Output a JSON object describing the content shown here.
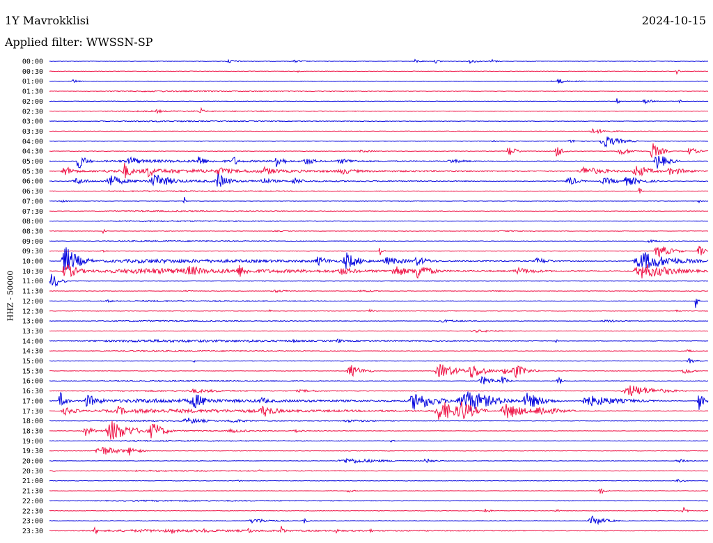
{
  "header": {
    "station": "1Y Mavrokklisi",
    "date": "2024-10-15",
    "filter_text": "Applied filter: WWSSN-SP"
  },
  "chart_data": {
    "type": "line",
    "title": "1Y Mavrokklisi",
    "date": "2024-10-15",
    "filter": "WWSSN-SP",
    "ylabel": "HHZ - 50000",
    "xrange": [
      0,
      30
    ],
    "grid": false,
    "colors": [
      "#0000dd",
      "#ee1144"
    ],
    "rows": [
      {
        "time": "00:00",
        "bursts": [
          [
            8.0,
            1.0,
            3
          ],
          [
            11.0,
            1.2,
            2
          ],
          [
            16.5,
            0.8,
            3
          ],
          [
            17.5,
            0.6,
            3
          ],
          [
            19.0,
            1.0,
            3
          ],
          [
            20.0,
            0.6,
            4
          ]
        ]
      },
      {
        "time": "00:30",
        "bursts": [
          [
            28.5,
            0.3,
            6
          ],
          [
            11.3,
            0.2,
            2
          ]
        ]
      },
      {
        "time": "01:00",
        "bursts": [
          [
            1.0,
            0.6,
            3
          ],
          [
            22.0,
            8.0,
            1
          ],
          [
            23.0,
            0.8,
            5
          ]
        ]
      },
      {
        "time": "01:30",
        "bursts": [
          [
            0.0,
            30.0,
            1
          ]
        ]
      },
      {
        "time": "02:00",
        "bursts": [
          [
            25.8,
            0.3,
            6
          ],
          [
            27.0,
            0.8,
            4
          ],
          [
            28.6,
            0.4,
            3
          ]
        ]
      },
      {
        "time": "02:30",
        "bursts": [
          [
            4.8,
            0.7,
            3
          ],
          [
            6.8,
            0.4,
            6
          ],
          [
            0.0,
            30.0,
            1
          ]
        ]
      },
      {
        "time": "03:00",
        "bursts": [
          [
            0.0,
            30.0,
            1
          ]
        ]
      },
      {
        "time": "03:30",
        "bursts": [
          [
            24.5,
            1.8,
            4
          ],
          [
            8.3,
            0.3,
            1
          ]
        ]
      },
      {
        "time": "04:00",
        "bursts": [
          [
            25.0,
            1.8,
            9
          ],
          [
            23.5,
            1.5,
            2
          ],
          [
            20.0,
            1.5,
            1
          ]
        ]
      },
      {
        "time": "04:30",
        "bursts": [
          [
            20.8,
            0.8,
            9
          ],
          [
            23.0,
            0.7,
            10
          ],
          [
            25.8,
            1.2,
            6
          ],
          [
            27.3,
            1.0,
            13
          ],
          [
            29.0,
            1.0,
            6
          ],
          [
            14.0,
            1.5,
            2
          ]
        ]
      },
      {
        "time": "05:00",
        "bursts": [
          [
            0.0,
            30.0,
            2
          ],
          [
            1.2,
            0.8,
            13
          ],
          [
            3.5,
            1.2,
            8
          ],
          [
            6.7,
            0.6,
            12
          ],
          [
            8.3,
            0.5,
            9
          ],
          [
            10.2,
            0.8,
            12
          ],
          [
            11.5,
            1.2,
            6
          ],
          [
            13.0,
            2.0,
            4
          ],
          [
            18.0,
            2.0,
            3
          ],
          [
            27.5,
            1.2,
            12
          ]
        ]
      },
      {
        "time": "05:30",
        "bursts": [
          [
            0.0,
            30.0,
            3
          ],
          [
            0.5,
            1.2,
            8
          ],
          [
            3.3,
            0.8,
            13
          ],
          [
            4.3,
            1.2,
            10
          ],
          [
            7.5,
            1.6,
            7
          ],
          [
            9.5,
            2.0,
            6
          ],
          [
            13.0,
            2.0,
            5
          ],
          [
            24.0,
            2.5,
            7
          ],
          [
            26.5,
            1.5,
            10
          ],
          [
            28.0,
            2.0,
            6
          ]
        ]
      },
      {
        "time": "06:00",
        "bursts": [
          [
            0.0,
            30.0,
            2
          ],
          [
            1.0,
            1.5,
            5
          ],
          [
            2.5,
            1.5,
            10
          ],
          [
            4.5,
            2.0,
            11
          ],
          [
            7.5,
            1.2,
            12
          ],
          [
            9.5,
            1.5,
            5
          ],
          [
            11.0,
            1.0,
            6
          ],
          [
            23.5,
            1.0,
            8
          ],
          [
            25.0,
            2.0,
            5
          ],
          [
            26.0,
            2.0,
            7
          ]
        ]
      },
      {
        "time": "06:30",
        "bursts": [
          [
            0.0,
            30.0,
            1
          ],
          [
            26.8,
            0.3,
            6
          ]
        ]
      },
      {
        "time": "07:00",
        "bursts": [
          [
            6.1,
            0.2,
            8
          ],
          [
            0.3,
            1.0,
            2
          ],
          [
            29.5,
            0.3,
            3
          ]
        ]
      },
      {
        "time": "07:30",
        "bursts": [
          [
            0.0,
            30.0,
            1
          ]
        ]
      },
      {
        "time": "08:00",
        "bursts": [
          [
            0.0,
            30.0,
            1
          ]
        ]
      },
      {
        "time": "08:30",
        "bursts": [
          [
            2.4,
            0.3,
            4
          ],
          [
            10.0,
            2.0,
            1
          ],
          [
            20.0,
            5.0,
            1
          ]
        ]
      },
      {
        "time": "09:00",
        "bursts": [
          [
            0.0,
            30.0,
            1
          ],
          [
            27.0,
            2.0,
            2
          ]
        ]
      },
      {
        "time": "09:30",
        "bursts": [
          [
            2.3,
            0.5,
            3
          ],
          [
            15.0,
            0.3,
            9
          ],
          [
            27.5,
            1.5,
            10
          ],
          [
            29.5,
            0.5,
            12
          ]
        ]
      },
      {
        "time": "10:00",
        "bursts": [
          [
            0.0,
            30.0,
            3
          ],
          [
            0.5,
            1.5,
            22
          ],
          [
            12.0,
            1.5,
            7
          ],
          [
            13.3,
            1.5,
            13
          ],
          [
            15.0,
            2.5,
            6
          ],
          [
            16.5,
            1.5,
            7
          ],
          [
            22.0,
            1.5,
            5
          ],
          [
            26.5,
            3.5,
            14
          ]
        ]
      },
      {
        "time": "10:30",
        "bursts": [
          [
            0.0,
            30.0,
            4
          ],
          [
            0.5,
            1.5,
            12
          ],
          [
            6.0,
            2.5,
            8
          ],
          [
            8.5,
            1.0,
            10
          ],
          [
            13.0,
            2.0,
            6
          ],
          [
            15.5,
            1.5,
            10
          ],
          [
            16.5,
            1.5,
            13
          ],
          [
            21.0,
            2.5,
            5
          ],
          [
            26.5,
            3.5,
            12
          ]
        ]
      },
      {
        "time": "11:00",
        "bursts": [
          [
            0.0,
            0.8,
            13
          ]
        ]
      },
      {
        "time": "11:30",
        "bursts": [
          [
            6.0,
            1.5,
            1
          ],
          [
            10.0,
            2.0,
            2
          ],
          [
            14.0,
            1.5,
            2
          ],
          [
            20.0,
            1.5,
            1
          ]
        ]
      },
      {
        "time": "12:00",
        "bursts": [
          [
            0.0,
            30.0,
            1
          ],
          [
            2.5,
            1.0,
            2
          ],
          [
            29.4,
            0.2,
            12
          ]
        ]
      },
      {
        "time": "12:30",
        "bursts": [
          [
            10.0,
            0.2,
            3
          ],
          [
            14.5,
            0.5,
            3
          ],
          [
            28.5,
            0.3,
            4
          ]
        ]
      },
      {
        "time": "13:00",
        "bursts": [
          [
            0.0,
            30.0,
            1
          ],
          [
            17.5,
            3.0,
            2
          ],
          [
            25.0,
            2.5,
            2
          ]
        ]
      },
      {
        "time": "13:30",
        "bursts": [
          [
            19.0,
            3.0,
            2
          ]
        ]
      },
      {
        "time": "14:00",
        "bursts": [
          [
            0.0,
            30.0,
            2
          ],
          [
            9.0,
            1.0,
            3
          ],
          [
            11.0,
            0.8,
            3
          ],
          [
            13.0,
            0.7,
            4
          ],
          [
            23.0,
            0.4,
            3
          ]
        ]
      },
      {
        "time": "14:30",
        "bursts": [
          [
            0.0,
            30.0,
            1
          ],
          [
            29.0,
            0.5,
            3
          ]
        ]
      },
      {
        "time": "15:00",
        "bursts": [
          [
            6.5,
            0.2,
            4
          ],
          [
            29.0,
            0.8,
            4
          ]
        ]
      },
      {
        "time": "15:30",
        "bursts": [
          [
            13.5,
            1.3,
            10
          ],
          [
            17.5,
            2.0,
            11
          ],
          [
            19.0,
            1.5,
            12
          ],
          [
            20.5,
            1.5,
            5
          ],
          [
            21.0,
            1.3,
            11
          ],
          [
            28.8,
            0.8,
            6
          ]
        ]
      },
      {
        "time": "16:00",
        "bursts": [
          [
            0.0,
            30.0,
            1
          ],
          [
            19.5,
            1.5,
            7
          ],
          [
            20.5,
            0.6,
            9
          ],
          [
            23.1,
            0.4,
            9
          ]
        ]
      },
      {
        "time": "16:30",
        "bursts": [
          [
            0.0,
            30.0,
            1
          ],
          [
            6.0,
            4.0,
            3
          ],
          [
            11.0,
            3.0,
            2
          ],
          [
            26.0,
            3.0,
            9
          ]
        ]
      },
      {
        "time": "17:00",
        "bursts": [
          [
            0.0,
            30.0,
            3
          ],
          [
            0.4,
            0.6,
            14
          ],
          [
            1.5,
            1.5,
            10
          ],
          [
            6.3,
            1.8,
            12
          ],
          [
            9.5,
            1.0,
            6
          ],
          [
            16.3,
            2.3,
            15
          ],
          [
            18.5,
            3.0,
            18
          ],
          [
            21.5,
            1.8,
            13
          ],
          [
            24.0,
            4.0,
            8
          ],
          [
            29.5,
            0.5,
            14
          ]
        ]
      },
      {
        "time": "17:30",
        "bursts": [
          [
            0.0,
            30.0,
            3
          ],
          [
            0.5,
            1.5,
            6
          ],
          [
            3.0,
            1.0,
            8
          ],
          [
            9.5,
            1.5,
            10
          ],
          [
            17.5,
            2.0,
            17
          ],
          [
            18.5,
            1.5,
            18
          ],
          [
            20.5,
            2.0,
            13
          ],
          [
            22.0,
            2.0,
            9
          ]
        ]
      },
      {
        "time": "18:00",
        "bursts": [
          [
            0.0,
            30.0,
            1
          ],
          [
            6.0,
            2.0,
            5
          ],
          [
            8.0,
            2.0,
            3
          ],
          [
            13.0,
            4.0,
            2
          ]
        ]
      },
      {
        "time": "18:30",
        "bursts": [
          [
            0.0,
            30.0,
            1
          ],
          [
            1.5,
            1.0,
            7
          ],
          [
            2.5,
            2.2,
            16
          ],
          [
            4.5,
            1.2,
            15
          ],
          [
            8.0,
            2.0,
            3
          ],
          [
            11.0,
            1.0,
            3
          ]
        ]
      },
      {
        "time": "19:00",
        "bursts": [
          [
            0.0,
            30.0,
            1
          ],
          [
            15.5,
            0.3,
            3
          ]
        ]
      },
      {
        "time": "19:30",
        "bursts": [
          [
            2.0,
            2.0,
            8
          ],
          [
            3.5,
            1.0,
            7
          ]
        ]
      },
      {
        "time": "20:00",
        "bursts": [
          [
            13.0,
            4.0,
            4
          ],
          [
            17.0,
            1.0,
            4
          ],
          [
            28.5,
            1.0,
            4
          ]
        ]
      },
      {
        "time": "20:30",
        "bursts": [
          [
            0.0,
            30.0,
            1
          ],
          [
            0.0,
            0.3,
            4
          ],
          [
            9.5,
            0.3,
            3
          ]
        ]
      },
      {
        "time": "21:00",
        "bursts": [
          [
            8.5,
            0.5,
            2
          ],
          [
            28.5,
            0.6,
            4
          ]
        ]
      },
      {
        "time": "21:30",
        "bursts": [
          [
            13.5,
            0.6,
            3
          ],
          [
            25.0,
            0.5,
            7
          ]
        ]
      },
      {
        "time": "22:00",
        "bursts": [
          [
            0.0,
            30.0,
            1
          ]
        ]
      },
      {
        "time": "22:30",
        "bursts": [
          [
            19.8,
            0.4,
            6
          ],
          [
            23.0,
            0.4,
            3
          ],
          [
            28.8,
            0.4,
            6
          ]
        ]
      },
      {
        "time": "23:00",
        "bursts": [
          [
            9.0,
            2.0,
            4
          ],
          [
            11.5,
            0.4,
            6
          ],
          [
            24.5,
            1.5,
            7
          ]
        ]
      },
      {
        "time": "23:30",
        "bursts": [
          [
            0.0,
            30.0,
            2
          ],
          [
            2.0,
            0.4,
            6
          ],
          [
            4.0,
            0.4,
            4
          ],
          [
            5.5,
            0.4,
            6
          ],
          [
            7.0,
            0.4,
            6
          ],
          [
            9.0,
            0.4,
            6
          ],
          [
            10.5,
            0.4,
            7
          ],
          [
            13.0,
            0.3,
            5
          ],
          [
            14.5,
            0.3,
            6
          ]
        ]
      }
    ]
  }
}
